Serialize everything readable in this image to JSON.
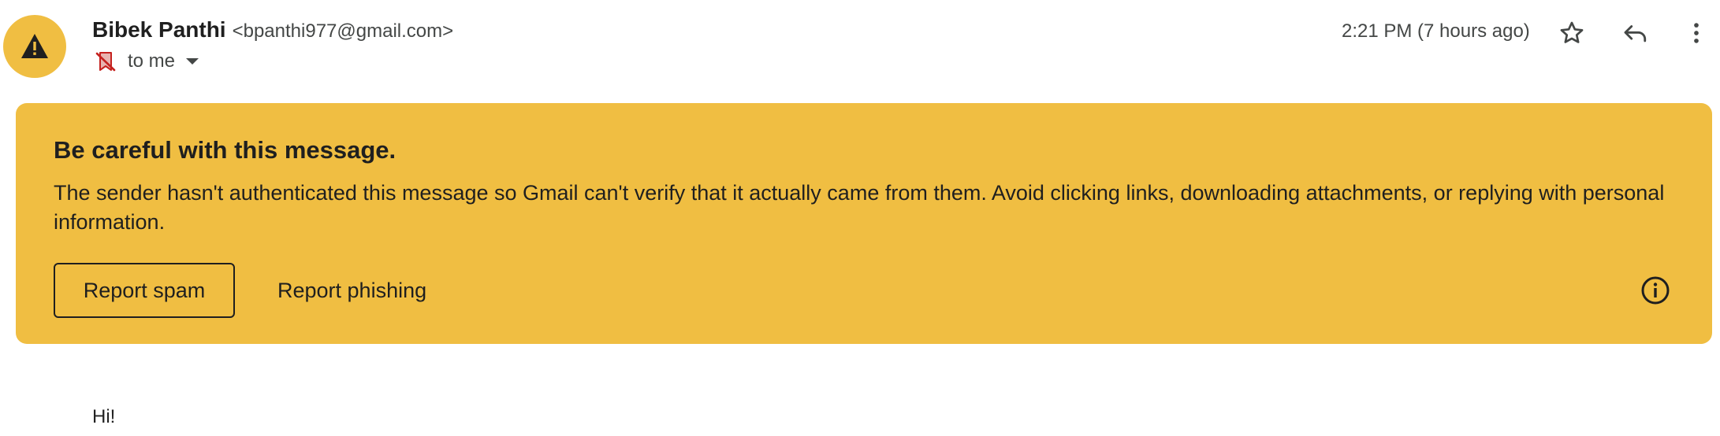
{
  "sender": {
    "name": "Bibek Panthi",
    "email": "<bpanthi977@gmail.com>",
    "avatar_icon": "warning-triangle-icon",
    "avatar_color": "#f0be42"
  },
  "recipient": {
    "label": "to me",
    "status_icon": "unauthenticated-sender-icon",
    "expand_icon": "chevron-down-icon"
  },
  "timestamp": "2:21 PM (7 hours ago)",
  "header_actions": {
    "star_icon": "star-icon",
    "reply_icon": "reply-icon",
    "more_icon": "more-vert-icon"
  },
  "warning_banner": {
    "background": "#f0be42",
    "title": "Be careful with this message.",
    "body": "The sender hasn't authenticated this message so Gmail can't verify that it actually came from them. Avoid clicking links, downloading attachments, or replying with personal information.",
    "report_spam_label": "Report spam",
    "report_phishing_label": "Report phishing",
    "info_icon": "info-icon"
  },
  "message": {
    "text": "Hi!"
  }
}
